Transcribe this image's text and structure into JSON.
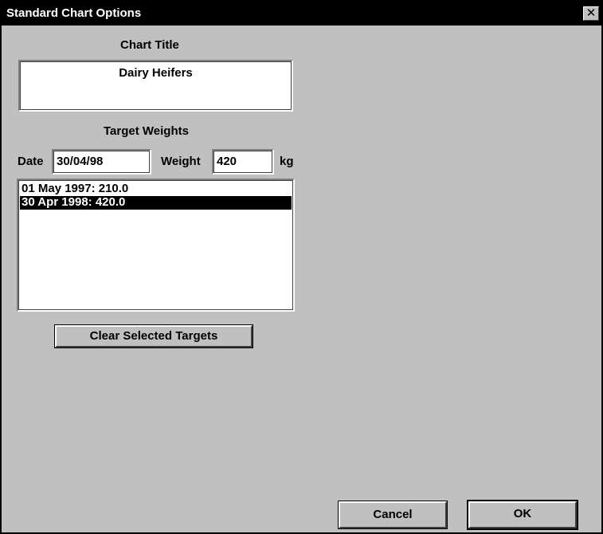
{
  "window": {
    "title": "Standard Chart Options",
    "close_glyph": "✕"
  },
  "chart_title": {
    "label": "Chart Title",
    "value": "Dairy Heifers"
  },
  "target_weights": {
    "heading": "Target Weights",
    "date_label": "Date",
    "date_value": "30/04/98",
    "weight_label": "Weight",
    "weight_value": "420",
    "unit_label": "kg",
    "items": [
      {
        "text": "01 May 1997: 210.0",
        "selected": false
      },
      {
        "text": "30 Apr 1998: 420.0",
        "selected": true
      }
    ],
    "clear_button": "Clear Selected Targets"
  },
  "footer": {
    "cancel_label": "Cancel",
    "ok_label": "OK"
  },
  "colors": {
    "face": "#c0c0c0",
    "titlebar": "#000000",
    "selection": "#000000"
  }
}
